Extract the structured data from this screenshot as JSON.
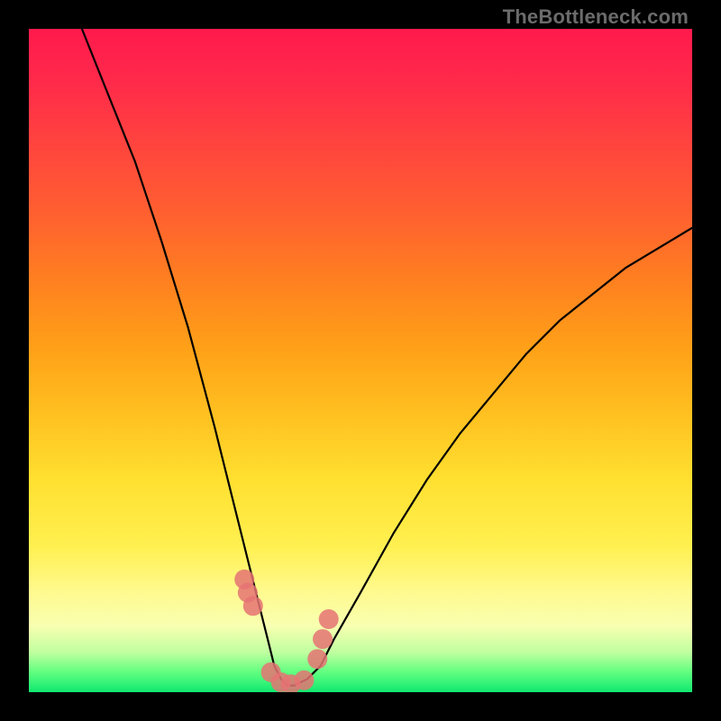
{
  "watermark": "TheBottleneck.com",
  "chart_data": {
    "type": "line",
    "title": "",
    "xlabel": "",
    "ylabel": "",
    "xlim": [
      0,
      100
    ],
    "ylim": [
      0,
      100
    ],
    "series": [
      {
        "name": "bottleneck-curve",
        "x": [
          8,
          12,
          16,
          20,
          24,
          28,
          30,
          32,
          34,
          36,
          37,
          38,
          39,
          40,
          42,
          44,
          46,
          50,
          55,
          60,
          65,
          70,
          75,
          80,
          85,
          90,
          95,
          100
        ],
        "y": [
          100,
          90,
          80,
          68,
          55,
          40,
          32,
          24,
          16,
          8,
          4,
          2,
          1,
          1,
          2,
          4,
          8,
          15,
          24,
          32,
          39,
          45,
          51,
          56,
          60,
          64,
          67,
          70
        ]
      },
      {
        "name": "highlight-dots",
        "type": "scatter",
        "x": [
          32.5,
          33.0,
          33.8,
          36.5,
          38.0,
          39.5,
          41.5,
          43.5,
          44.3,
          45.2
        ],
        "y": [
          17,
          15,
          13,
          3,
          1.5,
          1.2,
          1.8,
          5,
          8,
          11
        ]
      }
    ],
    "colors": {
      "curve": "#000000",
      "dots": "#e57373",
      "gradient_top": "#ff1a4d",
      "gradient_bottom": "#10e870",
      "frame": "#000000"
    }
  }
}
